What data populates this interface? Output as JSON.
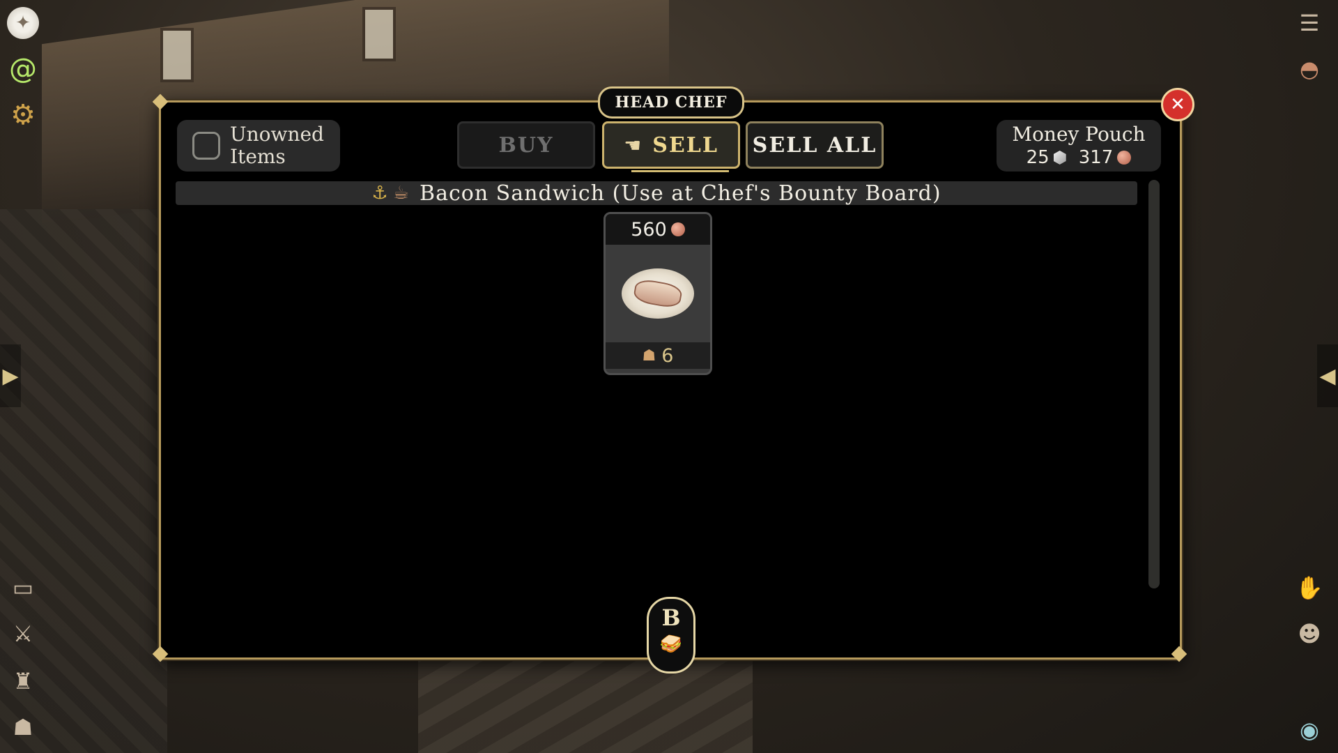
{
  "shop": {
    "title": "HEAD CHEF",
    "close_icon": "✕",
    "filter": {
      "label": "Unowned Items",
      "checked": false
    },
    "tabs": {
      "buy": "BUY",
      "sell": "SELL",
      "sell_all": "SELL ALL",
      "active": "sell"
    },
    "money_pouch": {
      "label": "Money Pouch",
      "silver": "25",
      "copper": "317"
    },
    "category": {
      "label": "Bacon Sandwich (Use at Chef's Bounty Board)",
      "icons": [
        "anchor-icon",
        "steaming-cup-icon"
      ]
    },
    "items": [
      {
        "name": "Bacon Sandwich",
        "price": "560",
        "price_currency": "copper",
        "quantity": "6"
      }
    ],
    "hotkey": {
      "key": "B",
      "icon": "sandwich-icon"
    }
  },
  "left_toolbar": [
    "compass-icon",
    "spiral-icon",
    "gear-icon",
    "bag-icon",
    "crossed-swords-icon",
    "helmet-icon",
    "backpack-icon"
  ],
  "right_toolbar": [
    "scroll-icon",
    "hat-icon",
    "hand-icon",
    "group-icon",
    "eye-icon"
  ],
  "colors": {
    "accent_gold": "#d3bb73",
    "close_red": "#d4302c",
    "panel_bg": "#000000"
  }
}
